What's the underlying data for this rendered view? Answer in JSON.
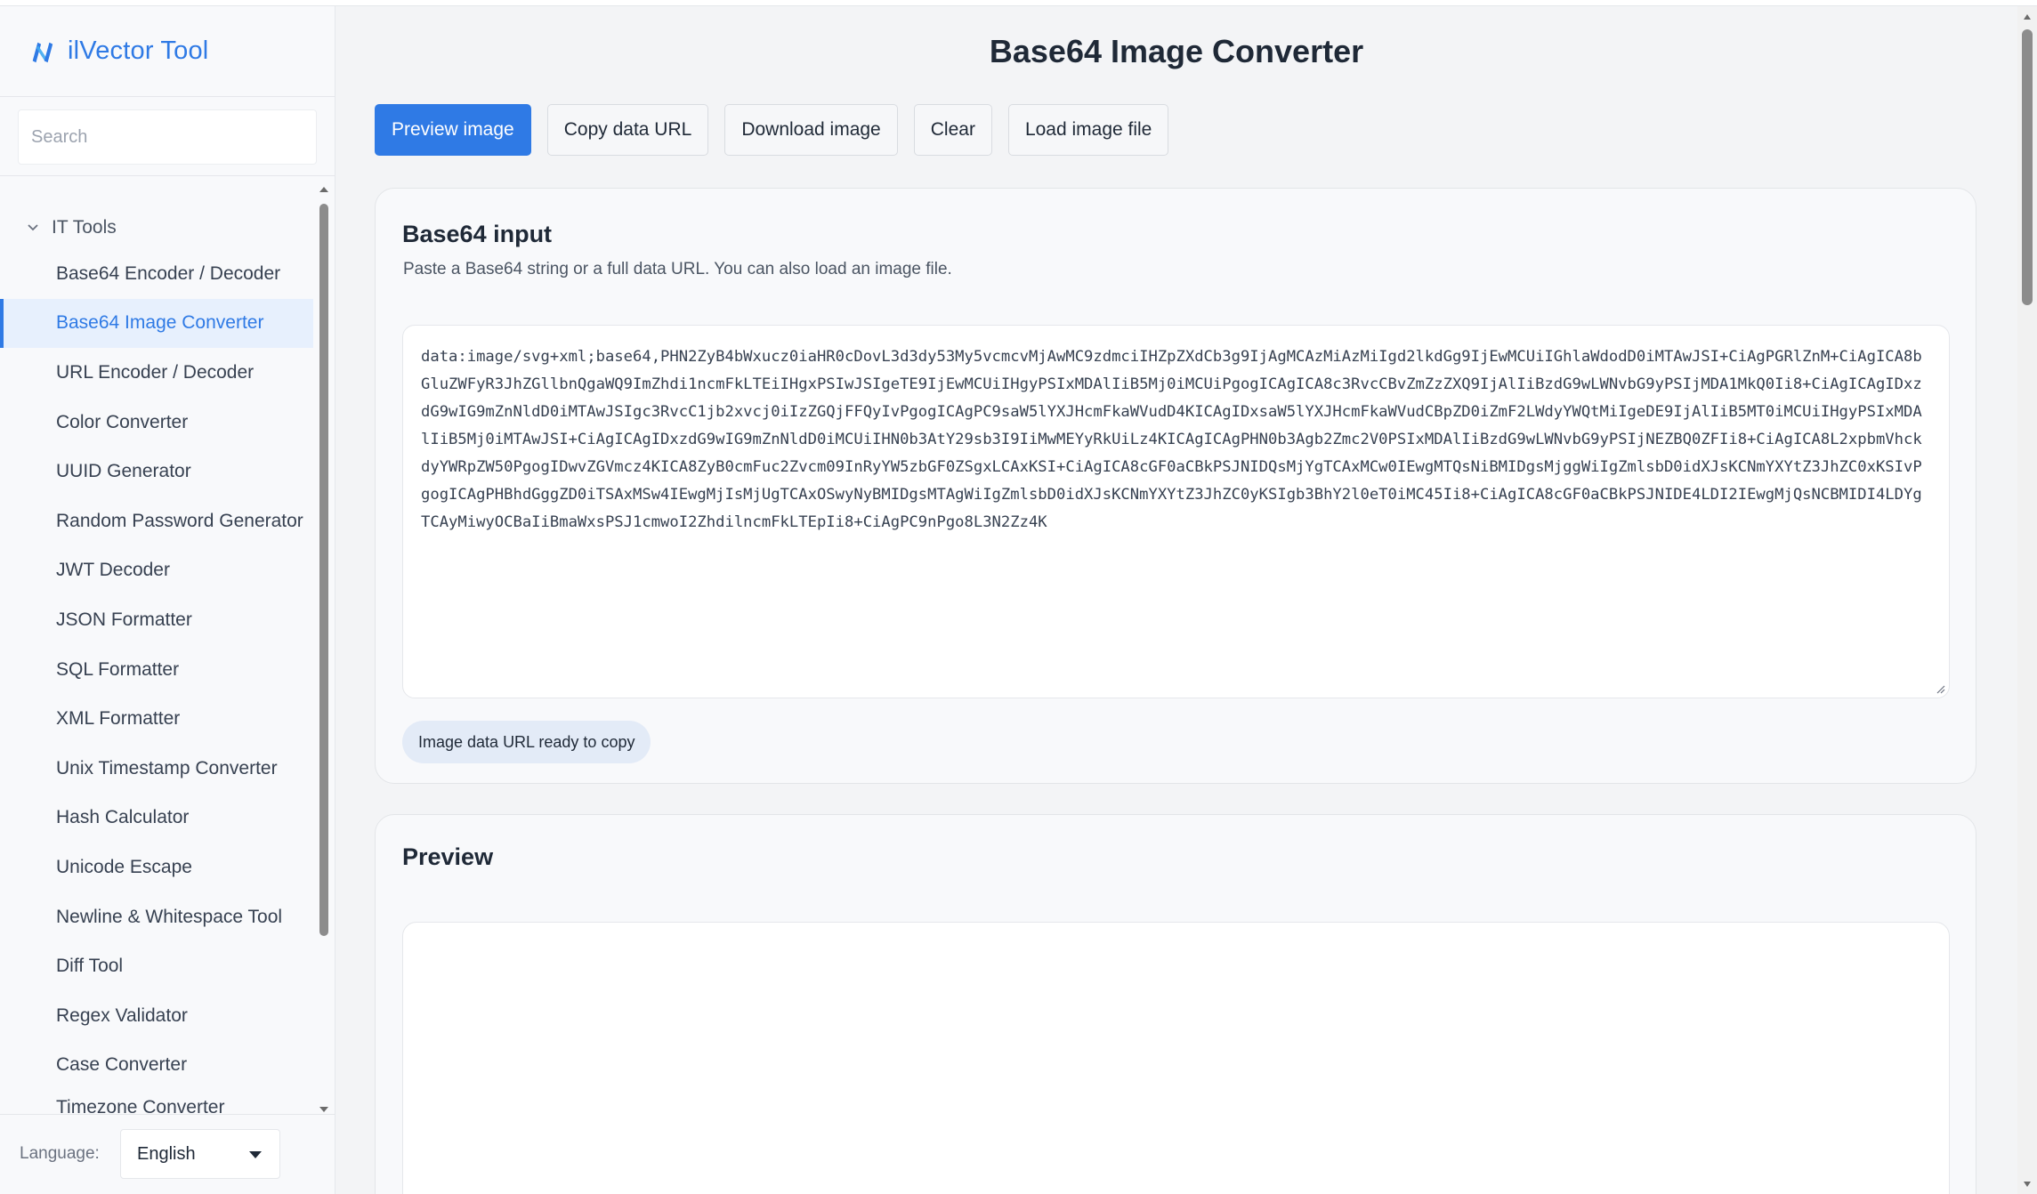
{
  "app": {
    "brand": "ilVector Tool",
    "accent_color": "#2f7ae5"
  },
  "sidebar": {
    "search_placeholder": "Search",
    "group_label": "IT Tools",
    "items": [
      {
        "label": "Base64 Encoder / Decoder",
        "active": false
      },
      {
        "label": "Base64 Image Converter",
        "active": true
      },
      {
        "label": "URL Encoder / Decoder",
        "active": false
      },
      {
        "label": "Color Converter",
        "active": false
      },
      {
        "label": "UUID Generator",
        "active": false
      },
      {
        "label": "Random Password Generator",
        "active": false
      },
      {
        "label": "JWT Decoder",
        "active": false
      },
      {
        "label": "JSON Formatter",
        "active": false
      },
      {
        "label": "SQL Formatter",
        "active": false
      },
      {
        "label": "XML Formatter",
        "active": false
      },
      {
        "label": "Unix Timestamp Converter",
        "active": false
      },
      {
        "label": "Hash Calculator",
        "active": false
      },
      {
        "label": "Unicode Escape",
        "active": false
      },
      {
        "label": "Newline & Whitespace Tool",
        "active": false
      },
      {
        "label": "Diff Tool",
        "active": false
      },
      {
        "label": "Regex Validator",
        "active": false
      },
      {
        "label": "Case Converter",
        "active": false
      },
      {
        "label": "Timezone Converter",
        "active": false
      }
    ],
    "language_label": "Language:",
    "language_value": "English"
  },
  "main": {
    "title": "Base64 Image Converter",
    "toolbar": {
      "preview": "Preview image",
      "copy": "Copy data URL",
      "download": "Download image",
      "clear": "Clear",
      "load": "Load image file"
    },
    "input_card": {
      "title": "Base64 input",
      "description": "Paste a Base64 string or a full data URL. You can also load an image file.",
      "value": "data:image/svg+xml;base64,PHN2ZyB4bWxucz0iaHR0cDovL3d3dy53My5vcmcvMjAwMC9zdmciIHZpZXdCb3g9IjAgMCAzMiAzMiIgd2lkdGg9IjEwMCUiIGhlaWdodD0iMTAwJSI+CiAgPGRlZnM+CiAgICA8bGluZWFyR3JhZGllbnQgaWQ9ImZhdi1ncmFkLTEiIHgxPSIwJSIgeTE9IjEwMCUiIHgyPSIxMDAlIiB5Mj0iMCUiPgogICAgICA8c3RvcCBvZmZzZXQ9IjAlIiBzdG9wLWNvbG9yPSIjMDA1MkQ0Ii8+CiAgICAgIDxzdG9wIG9mZnNldD0iMTAwJSIgc3RvcC1jb2xvcj0iIzZGQjFFQyIvPgogICAgPC9saW5lYXJHcmFkaWVudD4KICAgIDxsaW5lYXJHcmFkaWVudCBpZD0iZmF2LWdyYWQtMiIgeDE9IjAlIiB5MT0iMCUiIHgyPSIxMDAlIiB5Mj0iMTAwJSI+CiAgICAgIDxzdG9wIG9mZnNldD0iMCUiIHN0b3AtY29sb3I9IiMwMEYyRkUiLz4KICAgICAgPHN0b3Agb2Zmc2V0PSIxMDAlIiBzdG9wLWNvbG9yPSIjNEZBQ0ZFIi8+CiAgICA8L2xpbmVhckdyYWRpZW50PgogIDwvZGVmcz4KICA8ZyB0cmFuc2Zvcm09InRyYW5zbGF0ZSgxLCAxKSI+CiAgICA8cGF0aCBkPSJNIDQsMjYgTCAxMCw0IEwgMTQsNiBMIDgsMjggWiIgZmlsbD0idXJsKCNmYXYtZ3JhZC0xKSIvPgogICAgPHBhdGggZD0iTSAxMSw4IEwgMjIsMjUgTCAxOSwyNyBMIDgsMTAgWiIgZmlsbD0idXJsKCNmYXYtZ3JhZC0yKSIgb3BhY2l0eT0iMC45Ii8+CiAgICA8cGF0aCBkPSJNIDE4LDI2IEwgMjQsNCBMIDI4LDYgTCAyMiwyOCBaIiBmaWxsPSJ1cmwoI2ZhdilncmFkLTEpIi8+CiAgPC9nPgo8L3N2Zz4K",
      "status": "Image data URL ready to copy"
    },
    "preview_card": {
      "title": "Preview"
    }
  }
}
